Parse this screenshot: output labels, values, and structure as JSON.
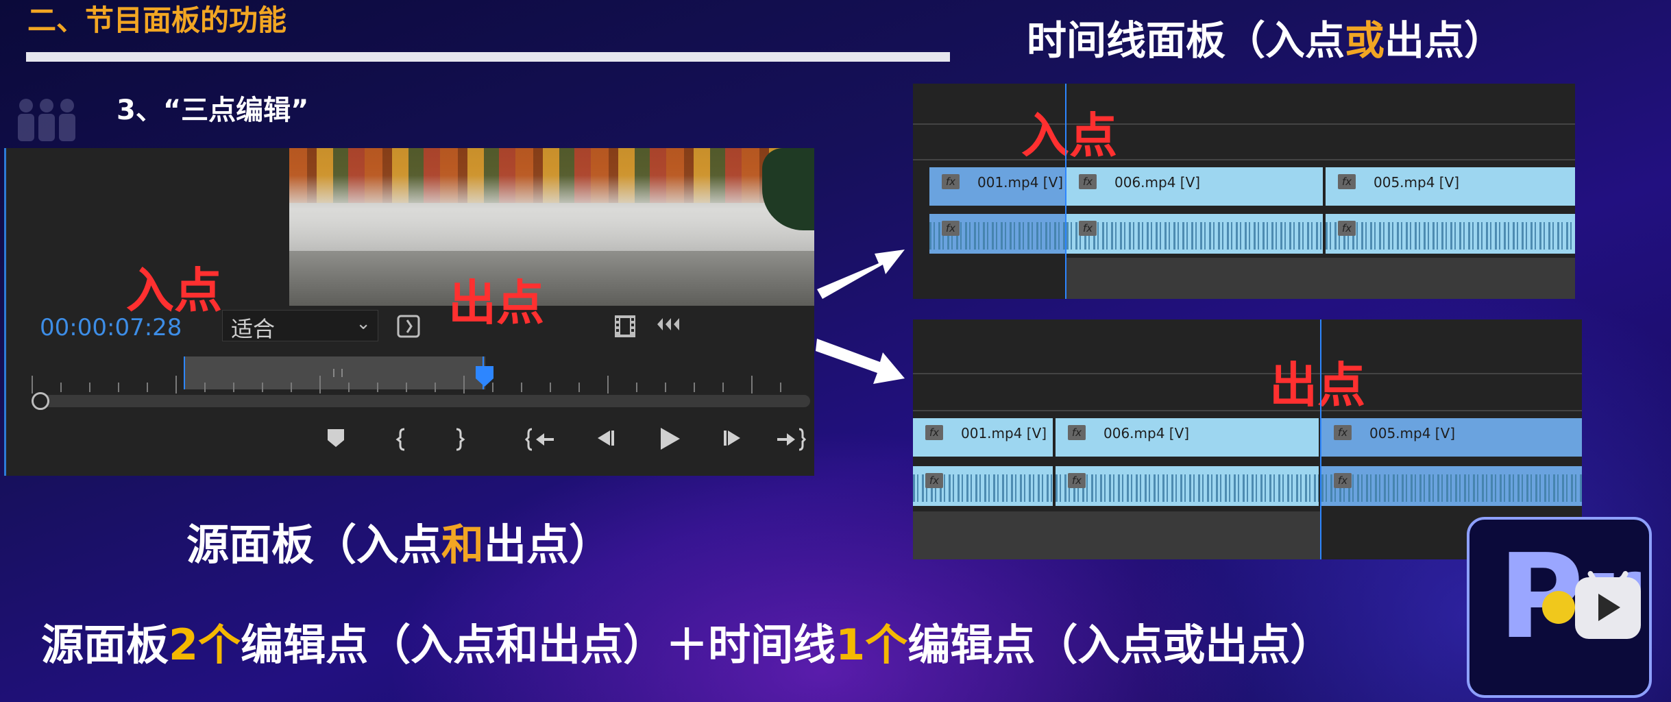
{
  "slide": {
    "section_title": "二、节目面板的功能",
    "subtitle": "3、“三点编辑”",
    "right_heading_pre": "时间线面板（入点",
    "right_heading_hl": "或",
    "right_heading_post": "出点）",
    "source_heading_pre": "源面板（入点",
    "source_heading_hl": "和",
    "source_heading_post": "出点）",
    "bottom_parts": [
      "源面板",
      "2个",
      "编辑点（入点和出点）＋时间线",
      "1个",
      "编辑点（入点或出点）"
    ]
  },
  "source_monitor": {
    "in_label": "入点",
    "out_label": "出点",
    "timecode": "00:00:07:28",
    "zoom_value": "适合",
    "icons": [
      "export-frame-icon",
      "film-icon",
      "audio-waveform-icon",
      "marker-icon",
      "mark-in-icon",
      "mark-out-icon",
      "go-to-in-icon",
      "step-back-icon",
      "play-icon",
      "step-forward-icon",
      "go-to-out-icon"
    ],
    "colors": {
      "in_out_label": "#ff3030",
      "timecode": "#3d8de6",
      "playhead": "#2d86ff"
    }
  },
  "timeline_top": {
    "marker_label": "入点",
    "clips": [
      {
        "fx": "fx",
        "name": "001.mp4 [V]",
        "selected": true
      },
      {
        "fx": "fx",
        "name": "006.mp4 [V]",
        "selected": false
      },
      {
        "fx": "fx",
        "name": "005.mp4 [V]",
        "selected": false
      }
    ],
    "audio_fx": [
      "fx",
      "fx",
      "fx"
    ]
  },
  "timeline_bottom": {
    "marker_label": "出点",
    "clips": [
      {
        "fx": "fx",
        "name": "001.mp4 [V]",
        "selected": false
      },
      {
        "fx": "fx",
        "name": "006.mp4 [V]",
        "selected": false
      },
      {
        "fx": "fx",
        "name": "005.mp4 [V]",
        "selected": true
      }
    ],
    "audio_fx": [
      "fx",
      "fx",
      "fx"
    ]
  },
  "logo": {
    "letter": "Pr"
  },
  "colors": {
    "accent_orange": "#f2a623",
    "clip_blue": "#9dd6f0",
    "clip_selected": "#6aa3df"
  }
}
